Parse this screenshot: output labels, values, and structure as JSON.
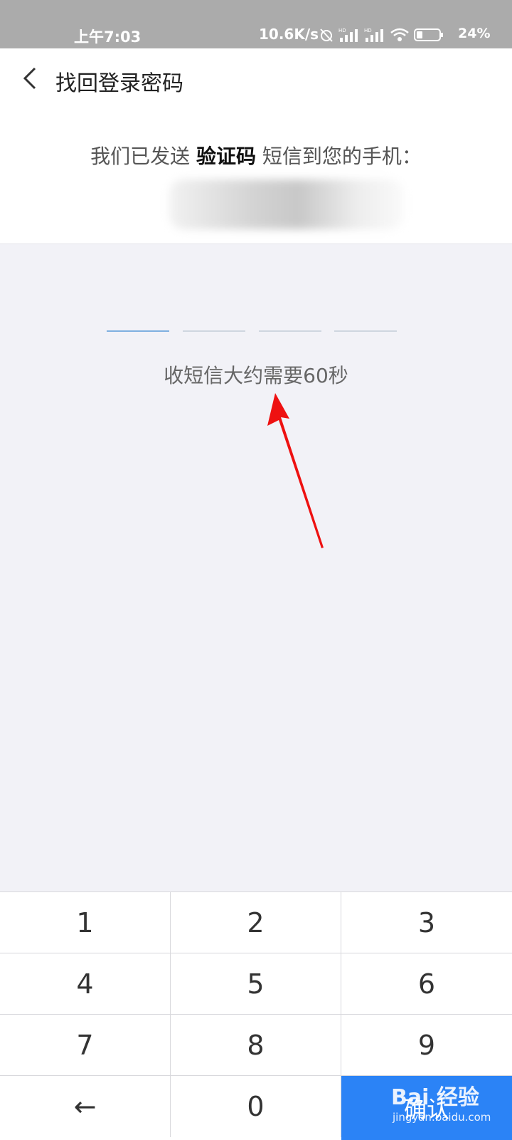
{
  "status_bar": {
    "time": "上午7:03",
    "speed": "10.6K/s",
    "battery": "24%"
  },
  "header": {
    "title": "找回登录密码",
    "back_icon": "chevron-left-icon"
  },
  "info": {
    "prefix": "我们已发送",
    "highlight": "验证码",
    "suffix": "短信到您的手机："
  },
  "code": {
    "slots": 4,
    "wait_text": "收短信大约需要60秒"
  },
  "keypad": {
    "keys": [
      "1",
      "2",
      "3",
      "4",
      "5",
      "6",
      "7",
      "8",
      "9",
      "←",
      "0",
      "确认"
    ]
  },
  "watermark": {
    "brand": "Bai 经验",
    "url": "jingyan.baidu.com"
  },
  "colors": {
    "accent": "#2b83f6",
    "arrow": "#ee1111"
  }
}
